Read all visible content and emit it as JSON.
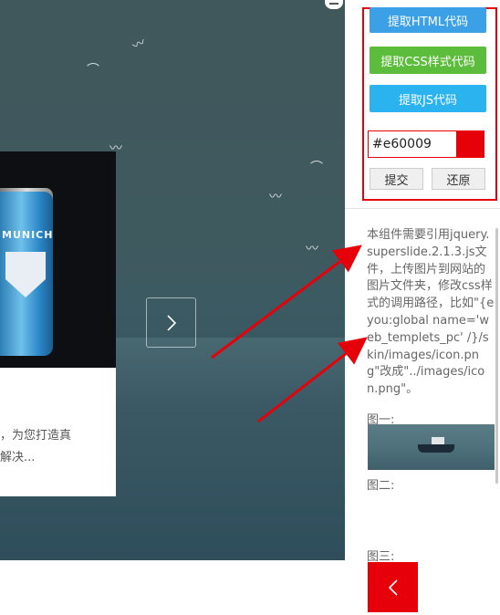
{
  "preview": {
    "card_text_line1": "，为您打造真",
    "card_text_line2": "解决...",
    "can_brand": "MUNICH"
  },
  "panel": {
    "btn_html": "提取HTML代码",
    "btn_css": "提取CSS样式代码",
    "btn_js": "提取JS代码",
    "color_value": "#e60009",
    "swatch_color": "#e60009",
    "submit_label": "提交",
    "reset_label": "还原",
    "description": "本组件需要引用jquery.superslide.2.1.3.js文件，上传图片到网站的图片文件夹，修改css样式的调用路径，比如\"{eyou:global name='web_templets_pc' /}/skin/images/icon.png\"改成\"../images/icon.png\"。",
    "img1_label": "图一:",
    "img2_label": "图二:",
    "img3_label": "图三:"
  },
  "icons": {
    "next": "chevron-right-icon",
    "prev": "chevron-left-icon",
    "minimize": "minimize-icon"
  },
  "colors": {
    "accent_red": "#e60009",
    "blue_button": "#3ca0e6",
    "green_button": "#5cbd3c",
    "cyan_button": "#2ab3ee"
  }
}
